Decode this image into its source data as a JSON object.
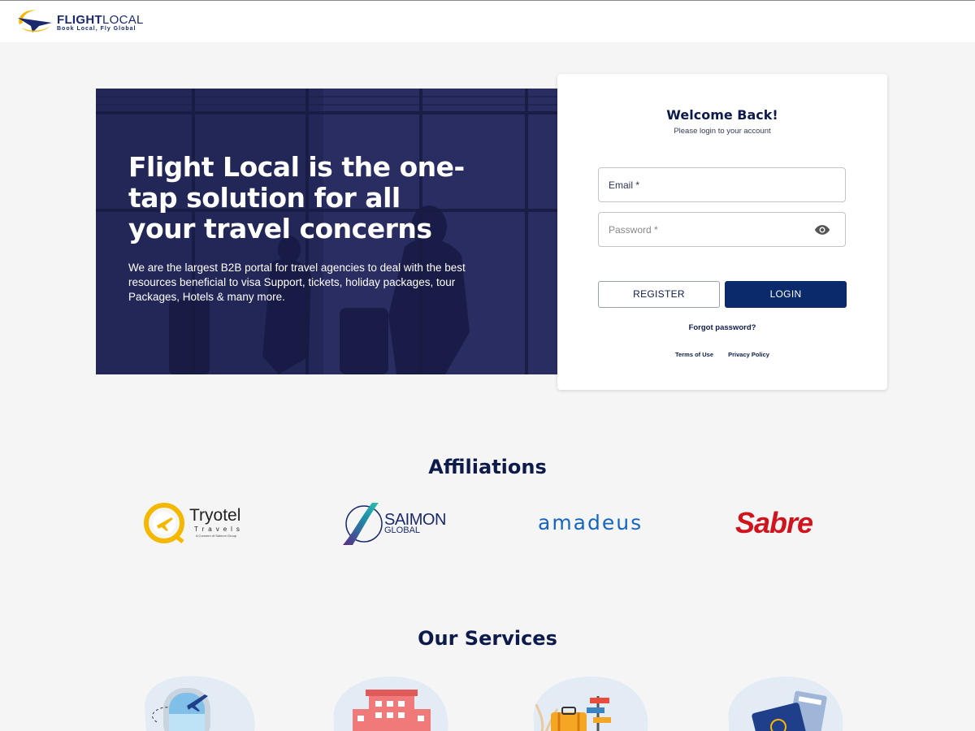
{
  "header": {
    "logo_title_bold": "FLIGHT",
    "logo_title_light": "LOCAL",
    "logo_tagline": "Book Local, Fly Global"
  },
  "hero": {
    "title": "Flight Local is the one-tap solution for all your travel concerns",
    "text": "We are the largest B2B portal for travel agencies to deal with the best resources beneficial to visa Support, tickets, holiday packages, tour Packages, Hotels & many more."
  },
  "login": {
    "title": "Welcome Back!",
    "subtitle": "Please login to your account",
    "email_placeholder": "Email *",
    "password_placeholder": "Password *",
    "register_label": "REGISTER",
    "login_label": "LOGIN",
    "forgot_label": "Forgot password?",
    "terms_label": "Terms of Use",
    "privacy_label": "Privacy Policy"
  },
  "affiliations": {
    "title": "Affiliations",
    "tryotel_name": "Tryotel",
    "tryotel_sub": "Travels",
    "tryotel_tag": "A Concern of Saimon Group",
    "saimon_name": "SAIMON",
    "saimon_sub": "GLOBAL",
    "amadeus_name": "amadeus",
    "sabre_name": "Sabre"
  },
  "services": {
    "title": "Our Services",
    "icons": [
      "flight-icon",
      "hotel-icon",
      "holiday-icon",
      "visa-icon"
    ]
  },
  "colors": {
    "primary": "#0b2a6b",
    "text_dark": "#0d1b4c",
    "page_bg": "#f5f5f5",
    "amadeus": "#1565c0",
    "sabre": "#d0141e",
    "tryotel": "#f5b800"
  }
}
